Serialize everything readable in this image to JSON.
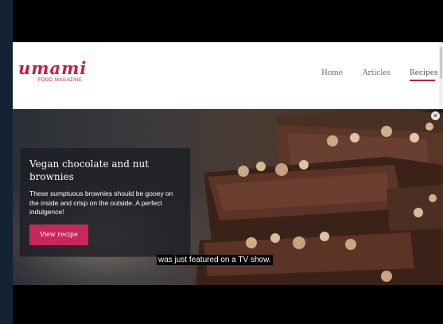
{
  "site": {
    "logo": {
      "name": "umami",
      "tagline": "FOOD MAGAZINE"
    },
    "nav": {
      "home": "Home",
      "articles": "Articles",
      "recipes": "Recipes",
      "active": "Recipes"
    }
  },
  "hero": {
    "title": "Vegan chocolate and nut brownies",
    "description": "These sumptuous brownies should be gooey on the inside and crisp on the outside. A perfect indulgence!",
    "button_label": "View recipe",
    "image_icon": "brownies-photo"
  },
  "video": {
    "caption": "was just featured on a TV show."
  },
  "colors": {
    "brand": "#c0213f",
    "button": "#c8275a",
    "frame": "#142233"
  }
}
